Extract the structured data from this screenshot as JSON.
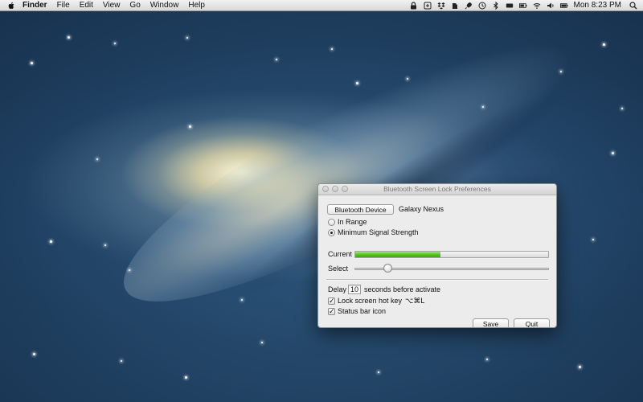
{
  "menubar": {
    "apple_icon": "apple-logo-icon",
    "items": [
      "Finder",
      "File",
      "Edit",
      "View",
      "Go",
      "Window",
      "Help"
    ],
    "status_icons": [
      "lock-icon",
      "safari-icon",
      "dropbox-icon",
      "evernote-icon",
      "rocket-icon",
      "time-machine-icon",
      "bluetooth-icon",
      "display-icon",
      "battery-icon",
      "wifi-icon",
      "volume-icon",
      "battery-icon-2"
    ],
    "clock": "Mon 8:23 PM"
  },
  "window": {
    "title": "Bluetooth Screen Lock Preferences",
    "device_button_label": "Bluetooth Device",
    "device_name": "Galaxy Nexus",
    "radio_in_range_label": "In Range",
    "radio_min_signal_label": "Minimum Signal Strength",
    "selected_mode": "Minimum Signal Strength",
    "current_label": "Current",
    "current_signal_fraction": 0.44,
    "select_label": "Select",
    "select_slider_fraction": 0.17,
    "delay_label": "Delay",
    "delay_value": "10",
    "delay_suffix": "seconds before activate",
    "lock_hotkey_label": "Lock screen hot key",
    "lock_hotkey_checked": true,
    "hotkey": "⌥⌘L",
    "status_bar_icon_label": "Status bar icon",
    "status_bar_icon_checked": true,
    "save_label": "Save",
    "quit_label": "Quit"
  },
  "colors": {
    "meter_green": "#52c022",
    "menubar_bg": "#e6e6e6",
    "window_bg": "#ececec"
  }
}
